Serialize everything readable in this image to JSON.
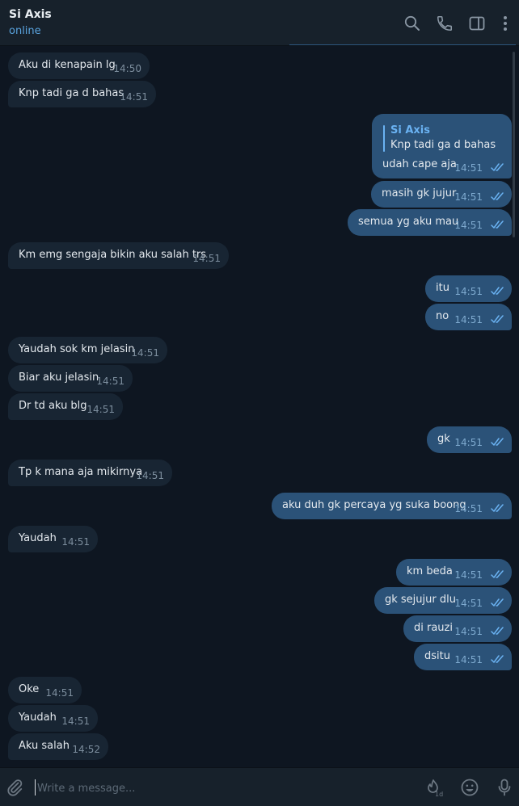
{
  "header": {
    "title": "Si Axis",
    "status": "online"
  },
  "reply": {
    "name": "Si Axis",
    "quote": "Knp tadi ga d bahas",
    "text": "udah cape aja",
    "time": "14:51"
  },
  "messages": [
    {
      "text": "Aku di kenapain lg",
      "time": "14:50",
      "dir": "in"
    },
    {
      "text": "Knp tadi ga d bahas",
      "time": "14:51",
      "dir": "in"
    },
    {
      "text": "masih gk jujur",
      "time": "14:51",
      "dir": "out"
    },
    {
      "text": "semua yg aku mau",
      "time": "14:51",
      "dir": "out"
    },
    {
      "text": "Km emg sengaja bikin aku salah trs",
      "time": "14:51",
      "dir": "in"
    },
    {
      "text": "itu",
      "time": "14:51",
      "dir": "out"
    },
    {
      "text": "no",
      "time": "14:51",
      "dir": "out"
    },
    {
      "text": "Yaudah sok km jelasin",
      "time": "14:51",
      "dir": "in"
    },
    {
      "text": "Biar aku jelasin",
      "time": "14:51",
      "dir": "in"
    },
    {
      "text": "Dr td aku blg",
      "time": "14:51",
      "dir": "in"
    },
    {
      "text": "gk",
      "time": "14:51",
      "dir": "out"
    },
    {
      "text": "Tp k mana aja mikirnya",
      "time": "14:51",
      "dir": "in"
    },
    {
      "text": "aku duh gk percaya yg suka boong",
      "time": "14:51",
      "dir": "out"
    },
    {
      "text": "Yaudah",
      "time": "14:51",
      "dir": "in"
    },
    {
      "text": "km beda",
      "time": "14:51",
      "dir": "out"
    },
    {
      "text": "gk sejujur dlu",
      "time": "14:51",
      "dir": "out"
    },
    {
      "text": "di rauzi",
      "time": "14:51",
      "dir": "out"
    },
    {
      "text": "dsitu",
      "time": "14:51",
      "dir": "out"
    },
    {
      "text": "Oke",
      "time": "14:51",
      "dir": "in"
    },
    {
      "text": "Yaudah",
      "time": "14:51",
      "dir": "in"
    },
    {
      "text": "Aku salah",
      "time": "14:52",
      "dir": "in"
    }
  ],
  "composer": {
    "placeholder": "Write a message...",
    "timer_label": "1d"
  },
  "icons": {
    "header": [
      "search-icon",
      "phone-icon",
      "sidebar-toggle-icon",
      "more-vertical-icon"
    ],
    "composer": [
      "paperclip-icon",
      "self-destruct-timer-icon",
      "emoji-icon",
      "microphone-icon"
    ]
  },
  "colors": {
    "background": "#0e1621",
    "panel": "#17212b",
    "incoming": "#182533",
    "outgoing": "#2b5278",
    "accent": "#6ab2f2",
    "status": "#5aa4df"
  }
}
